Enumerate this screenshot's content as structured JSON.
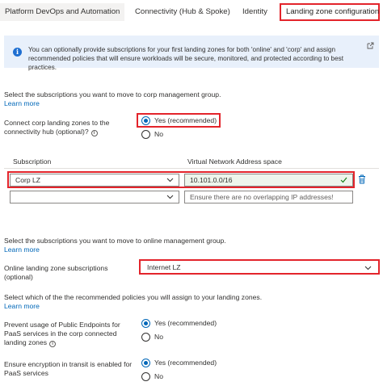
{
  "tabs": [
    {
      "label": "Platform DevOps and Automation"
    },
    {
      "label": "Connectivity (Hub & Spoke)"
    },
    {
      "label": "Identity"
    },
    {
      "label": "Landing zone configuration"
    }
  ],
  "info": {
    "text": "You can optionally provide subscriptions for your first landing zones for both 'online' and 'corp' and assign recommended policies that will ensure workloads will be secure, monitored, and protected according to best practices."
  },
  "corp": {
    "intro": "Select the subscriptions you want to move to corp management group.",
    "learn_more": "Learn more",
    "connect_label_1": "Connect corp landing zones to the",
    "connect_label_2": "connectivity hub (optional)?",
    "yes": "Yes (recommended)",
    "no": "No",
    "col_subscription": "Subscription",
    "col_vnet": "Virtual Network Address space",
    "rows": [
      {
        "subscription": "Corp LZ",
        "address": "10.101.0.0/16",
        "placeholder": ""
      },
      {
        "subscription": "",
        "address": "",
        "placeholder": "Ensure there are no overlapping IP addresses!"
      }
    ]
  },
  "online": {
    "intro": "Select the subscriptions you want to move to online management group.",
    "learn_more": "Learn more",
    "label_1": "Online landing zone subscriptions",
    "label_2": "(optional)",
    "value": "Internet LZ"
  },
  "policies": {
    "intro": "Select which of the the recommended policies you will assign to your landing zones.",
    "learn_more": "Learn more",
    "public_label_1": "Prevent usage of Public Endpoints for",
    "public_label_2": "PaaS services in the corp connected",
    "public_label_3": "landing zones",
    "encrypt_label_1": "Ensure encryption in transit is enabled for",
    "encrypt_label_2": "PaaS services",
    "yes": "Yes (recommended)",
    "no": "No"
  }
}
